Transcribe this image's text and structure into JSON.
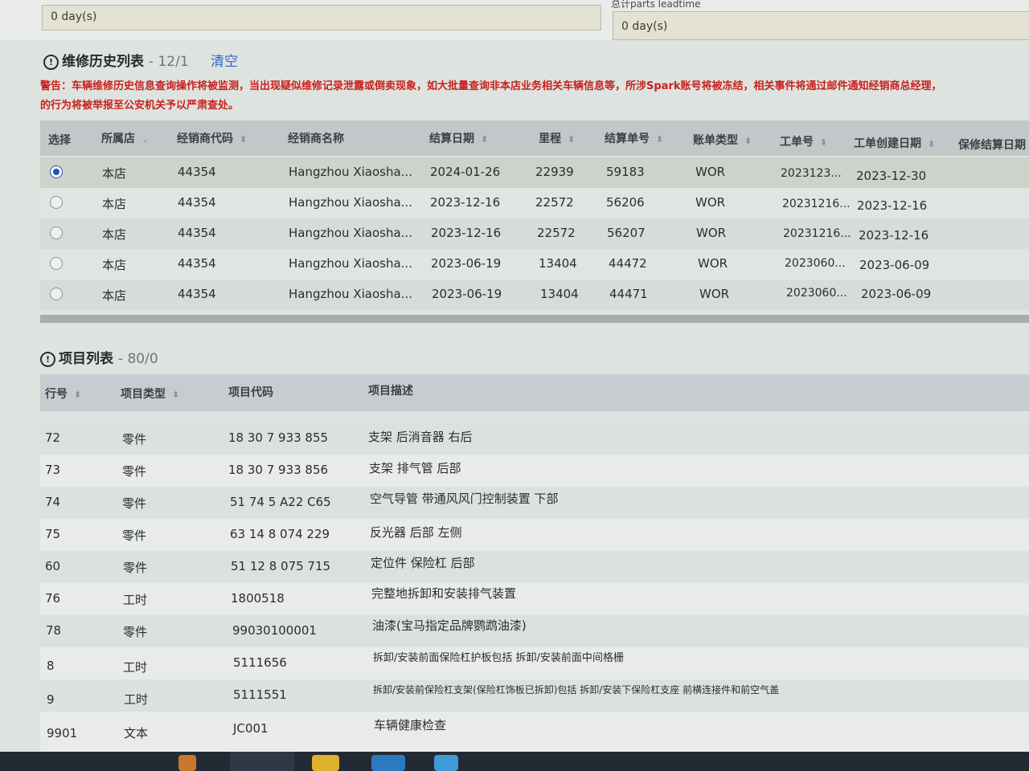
{
  "top": {
    "day_field_1": "0 day(s)",
    "leadtime_label": "总计parts leadtime",
    "day_field_2": "0 day(s)"
  },
  "history": {
    "title": "维修历史列表",
    "count": "- 12/1",
    "clear_label": "清空",
    "warning_line1": "警告：车辆维修历史信息查询操作将被监测，当出现疑似维修记录泄露或倒卖现象，如大批量查询非本店业务相关车辆信息等，所涉Spark账号将被冻结，相关事件将通过邮件通知经销商总经理，",
    "warning_line2": "的行为将被举报至公安机关予以严肃查处。",
    "columns": {
      "select": "选择",
      "store": "所属店",
      "dealer_code": "经销商代码",
      "dealer_name": "经销商名称",
      "settle_date": "结算日期",
      "mileage": "里程",
      "settle_no": "结算单号",
      "bill_type": "账单类型",
      "work_order": "工单号",
      "wo_created": "工单创建日期",
      "warranty_date": "保修结算日期"
    },
    "rows": [
      {
        "store": "本店",
        "dealer_code": "44354",
        "dealer_name": "Hangzhou Xiaosha...",
        "settle_date": "2024-01-26",
        "mileage": "22939",
        "settle_no": "59183",
        "bill_type": "WOR",
        "work_order": "2023123...",
        "wo_created": "2023-12-30"
      },
      {
        "store": "本店",
        "dealer_code": "44354",
        "dealer_name": "Hangzhou Xiaosha...",
        "settle_date": "2023-12-16",
        "mileage": "22572",
        "settle_no": "56206",
        "bill_type": "WOR",
        "work_order": "20231216...",
        "wo_created": "2023-12-16"
      },
      {
        "store": "本店",
        "dealer_code": "44354",
        "dealer_name": "Hangzhou Xiaosha...",
        "settle_date": "2023-12-16",
        "mileage": "22572",
        "settle_no": "56207",
        "bill_type": "WOR",
        "work_order": "20231216...",
        "wo_created": "2023-12-16"
      },
      {
        "store": "本店",
        "dealer_code": "44354",
        "dealer_name": "Hangzhou Xiaosha...",
        "settle_date": "2023-06-19",
        "mileage": "13404",
        "settle_no": "44472",
        "bill_type": "WOR",
        "work_order": "2023060...",
        "wo_created": "2023-06-09"
      },
      {
        "store": "本店",
        "dealer_code": "44354",
        "dealer_name": "Hangzhou Xiaosha...",
        "settle_date": "2023-06-19",
        "mileage": "13404",
        "settle_no": "44471",
        "bill_type": "WOR",
        "work_order": "2023060...",
        "wo_created": "2023-06-09"
      }
    ]
  },
  "items": {
    "title": "项目列表",
    "count": "- 80/0",
    "columns": {
      "line_no": "行号",
      "item_type": "项目类型",
      "item_code": "项目代码",
      "item_desc": "项目描述"
    },
    "rows": [
      {
        "line_no": "72",
        "type": "零件",
        "code": "18 30 7 933 855",
        "desc": "支架 后消音器 右后"
      },
      {
        "line_no": "73",
        "type": "零件",
        "code": "18 30 7 933 856",
        "desc": "支架 排气管 后部"
      },
      {
        "line_no": "74",
        "type": "零件",
        "code": "51 74 5 A22 C65",
        "desc": "空气导管 带通风风门控制装置 下部"
      },
      {
        "line_no": "75",
        "type": "零件",
        "code": "63 14 8 074 229",
        "desc": "反光器 后部 左侧"
      },
      {
        "line_no": "60",
        "type": "零件",
        "code": "51 12 8 075 715",
        "desc": "定位件 保险杠 后部"
      },
      {
        "line_no": "76",
        "type": "工时",
        "code": "1800518",
        "desc": "完整地拆卸和安装排气装置"
      },
      {
        "line_no": "78",
        "type": "零件",
        "code": "99030100001",
        "desc": "油漆(宝马指定品牌鹦鹉油漆)"
      },
      {
        "line_no": "8",
        "type": "工时",
        "code": "5111656",
        "desc": "拆卸/安装前面保险杠护板包括 拆卸/安装前面中间格栅"
      },
      {
        "line_no": "9",
        "type": "工时",
        "code": "5111551",
        "desc": "拆卸/安装前保险杠支架(保险杠饰板已拆卸)包括 拆卸/安装下保险杠支座 前横连接件和前空气盖"
      },
      {
        "line_no": "9901",
        "type": "文本",
        "code": "JC001",
        "desc": "车辆健康检查"
      }
    ]
  },
  "colors": {
    "warning": "#c8211b",
    "link": "#2f68c9",
    "radio_selected": "#2550b8",
    "taskbar": "#242a33"
  }
}
